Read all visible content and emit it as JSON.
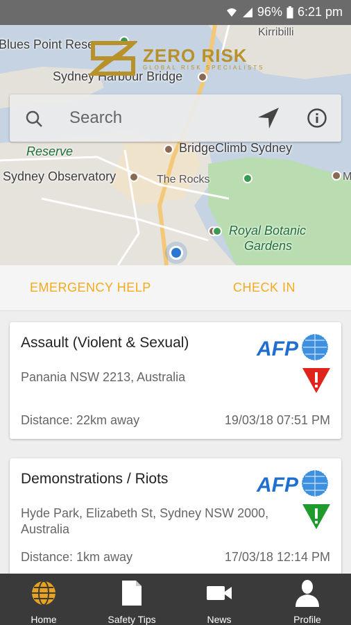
{
  "status_bar": {
    "battery": "96%",
    "time": "6:21 pm"
  },
  "brand": {
    "name": "ZERO RISK",
    "tagline": "GLOBAL RISK SPECIALISTS"
  },
  "map": {
    "labels": {
      "blues_point": "Blues Point Rese",
      "kirribilli": "Kirribilli",
      "harbour_bridge": "Sydney Harbour Bridge",
      "reserve": "Reserve",
      "bridgeclimb": "BridgeClimb Sydney",
      "observatory": "Sydney Observatory",
      "the_rocks": "The Rocks",
      "botanic_line1": "Royal Botanic",
      "botanic_line2": "Gardens",
      "edge_m": "M"
    }
  },
  "search": {
    "placeholder": "Search"
  },
  "actions": {
    "emergency": "EMERGENCY HELP",
    "checkin": "CHECK IN"
  },
  "incidents": [
    {
      "title": "Assault (Violent & Sexual)",
      "address": "Panania NSW 2213, Australia",
      "distance": "Distance: 22km away",
      "datetime": "19/03/18 07:51 PM",
      "source": "AFP",
      "severity_color": "#e0241b"
    },
    {
      "title": "Demonstrations / Riots",
      "address": "Hyde Park, Elizabeth St, Sydney NSW 2000, Australia",
      "distance": "Distance: 1km away",
      "datetime": "17/03/18 12:14 PM",
      "source": "AFP",
      "severity_color": "#1f9a2c"
    }
  ],
  "nav": [
    {
      "label": "Home",
      "icon": "globe-icon"
    },
    {
      "label": "Safety Tips",
      "icon": "document-icon"
    },
    {
      "label": "News",
      "icon": "video-camera-icon"
    },
    {
      "label": "Profile",
      "icon": "person-icon"
    }
  ],
  "colors": {
    "accent": "#f5a91c",
    "nav_bg": "#3a3a3a",
    "home_icon": "#e8a21b"
  }
}
